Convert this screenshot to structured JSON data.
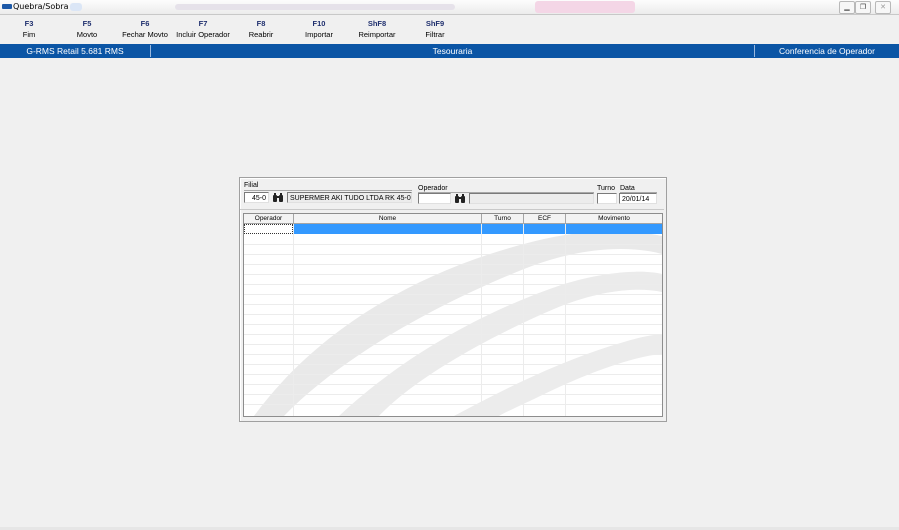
{
  "window": {
    "title": "Quebra/Sobra"
  },
  "toolbar": {
    "items": [
      {
        "key": "F3",
        "label": "Fim"
      },
      {
        "key": "F5",
        "label": "Movto"
      },
      {
        "key": "F6",
        "label": "Fechar Movto"
      },
      {
        "key": "F7",
        "label": "Incluir Operador"
      },
      {
        "key": "F8",
        "label": "Reabrir"
      },
      {
        "key": "F10",
        "label": "Importar"
      },
      {
        "key": "ShF8",
        "label": "Reimportar"
      },
      {
        "key": "ShF9",
        "label": "Filtrar"
      }
    ]
  },
  "statusbar": {
    "app": "G-RMS Retail 5.681 RMS",
    "module": "Tesouraria",
    "screen": "Conferencia de Operador",
    "color": "#0b55a5"
  },
  "form": {
    "filial_label": "Filial",
    "filial_value": "45-0",
    "filial_name": "SUPERMER AKI TUDO LTDA RK 45-0",
    "operador_label": "Operador",
    "operador_value": "",
    "operador_name": "",
    "turno_label": "Turno",
    "turno_value": "",
    "data_label": "Data",
    "data_value": "20/01/14",
    "search_icon": "binoculars-icon"
  },
  "grid": {
    "columns": [
      "Operador",
      "Nome",
      "Turno",
      "ECF",
      "Movimento"
    ],
    "rows": [],
    "selection_color": "#3399ff"
  }
}
